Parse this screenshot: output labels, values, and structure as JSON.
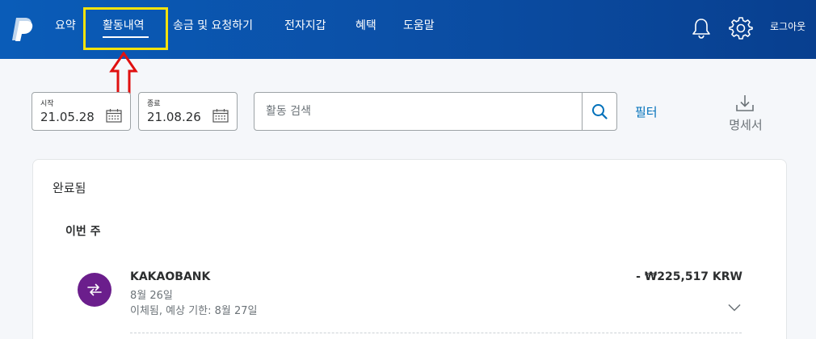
{
  "header": {
    "nav": [
      {
        "label": "요약"
      },
      {
        "label": "활동내역",
        "active": true
      },
      {
        "label": "송금 및 요청하기"
      },
      {
        "label": "전자지갑"
      },
      {
        "label": "혜택"
      },
      {
        "label": "도움말"
      }
    ],
    "icons": [
      "notification-bell-icon",
      "settings-gear-icon"
    ],
    "logout_label": "로그아웃",
    "brand_color": "#0b4fa6"
  },
  "annotations": {
    "highlight_color": "#f5e30c",
    "arrow_color": "#e01010"
  },
  "filters": {
    "start": {
      "label": "시작",
      "value": "21.05.28"
    },
    "end": {
      "label": "종료",
      "value": "21.08.26"
    },
    "search_placeholder": "활동 검색",
    "filter_label": "필터",
    "statement_label": "명세서"
  },
  "activity": {
    "section_title": "완료됨",
    "group_label": "이번 주",
    "transactions": [
      {
        "name": "KAKAOBANK",
        "date": "8월 26일",
        "status": "이체됨, 예상 기한: 8월 27일",
        "amount": "- ₩225,517 KRW",
        "avatar_color": "#6b1e8c",
        "icon": "transfer-arrows-icon"
      }
    ]
  }
}
